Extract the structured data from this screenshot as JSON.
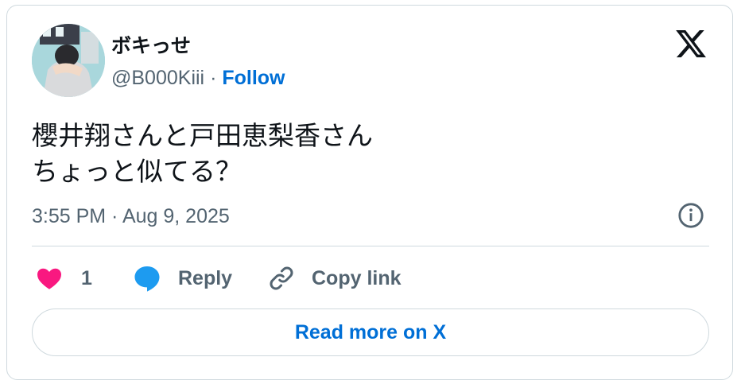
{
  "author": {
    "display_name": "ボキっせ",
    "handle": "@B000Kiii",
    "separator": "·",
    "follow_label": "Follow"
  },
  "tweet": {
    "text": "櫻井翔さんと戸田恵梨香さん\nちょっと似てる？",
    "timestamp": "3:55 PM · Aug 9, 2025"
  },
  "actions": {
    "like_count": "1",
    "reply_label": "Reply",
    "copy_link_label": "Copy link"
  },
  "footer": {
    "read_more_label": "Read more on X"
  },
  "icons": {
    "brand": "x-logo-icon",
    "info": "info-icon",
    "like": "heart-icon",
    "reply": "speech-bubble-icon",
    "copy": "link-icon"
  },
  "colors": {
    "link_blue": "#006fd6",
    "heart_pink": "#f91880",
    "reply_blue": "#1d9bf0",
    "muted_text": "#536471",
    "border": "#cfd9de"
  }
}
